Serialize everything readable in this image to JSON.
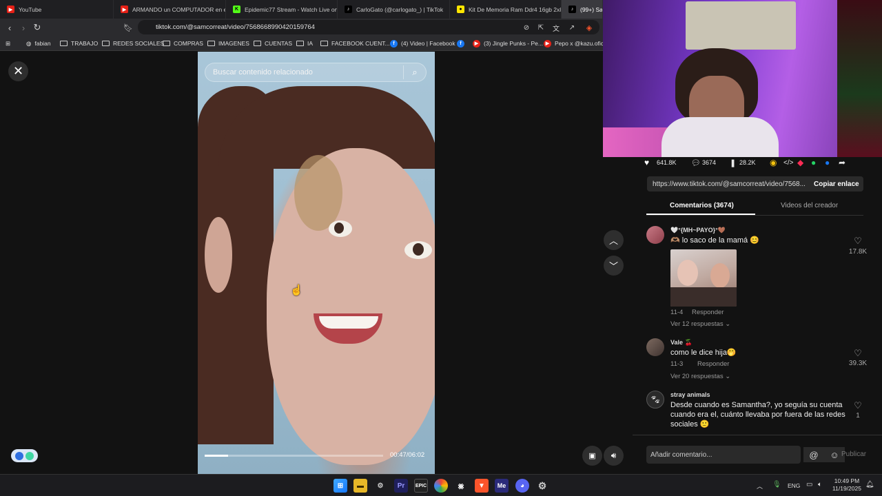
{
  "tabs": [
    {
      "title": "YouTube",
      "color": "#e62117"
    },
    {
      "title": "ARMANDO un COMPUTADOR en el",
      "color": "#e62117"
    },
    {
      "title": "Epidemic77 Stream - Watch Live on",
      "color": "#53fc18"
    },
    {
      "title": "CarloGato (@carlogato_) | TikTok",
      "color": "#000000"
    },
    {
      "title": "Kit De Memoria Ram Ddr4 16gb 2x8",
      "color": "#ffe600"
    },
    {
      "title": "(99+) Sa",
      "color": "#000000"
    }
  ],
  "toolbar": {
    "url": "tiktok.com/@samcorreat/video/7568668990420159764"
  },
  "bookmarks": [
    "fabian",
    "TRABAJO",
    "REDES SOCIALES",
    "COMPRAS",
    "IMAGENES",
    "CUENTAS",
    "IA",
    "FACEBOOK CUENT...",
    "(4) Video | Facebook",
    "(3) Jingle Punks - Pe...",
    "Pepo x @kazu.oficia..."
  ],
  "video": {
    "search_placeholder": "Buscar contenido relacionado",
    "time": "00:47/06:02",
    "progress": 0.13
  },
  "stats": {
    "likes": "641.8K",
    "comments": "3674",
    "saves": "28.2K"
  },
  "share_link": {
    "url": "https://www.tiktok.com/@samcorreat/video/7568...",
    "copy_label": "Copiar enlace"
  },
  "panel_tabs": {
    "comments": "Comentarios (3674)",
    "creator": "Videos del creador"
  },
  "comments": [
    {
      "name": "🤍°{MH~PAYO}°🤎",
      "text": "🫶🏽 lo saco de la mamá 😊",
      "date": "11-4",
      "reply": "Responder",
      "likes": "17.8K",
      "more": "Ver 12 respuestas"
    },
    {
      "name": "Vale 🍒",
      "text": "como le dice hija🤭",
      "date": "11-3",
      "reply": "Responder",
      "likes": "39.3K",
      "more": "Ver 20 respuestas"
    },
    {
      "name": "stray animals",
      "text": "Desde cuando es Samantha?, yo seguía su cuenta cuando era el, cuánto llevaba por fuera de las redes sociales 🙂",
      "likes": "1"
    }
  ],
  "comment_input": {
    "placeholder": "Añadir comentario...",
    "publish": "Publicar"
  },
  "taskbar": {
    "lang": "ENG",
    "time": "10:49 PM",
    "date": "11/19/2025"
  }
}
